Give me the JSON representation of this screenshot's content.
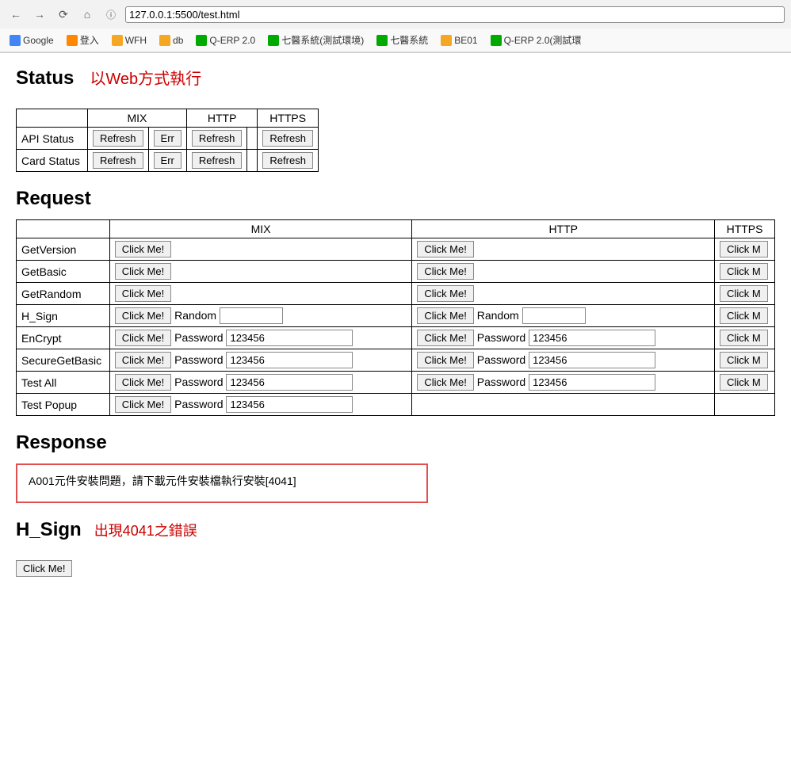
{
  "browser": {
    "url": "127.0.0.1:5500/test.html",
    "bookmarks": [
      {
        "label": "Google",
        "color": "#4285f4"
      },
      {
        "label": "登入",
        "color": "#ff8800"
      },
      {
        "label": "WFH",
        "color": "#f5a623"
      },
      {
        "label": "db",
        "color": "#f5a623"
      },
      {
        "label": "Q-ERP 2.0",
        "color": "#00aa00"
      },
      {
        "label": "七醫系統(測試環境)",
        "color": "#00aa00"
      },
      {
        "label": "七醫系統",
        "color": "#00aa00"
      },
      {
        "label": "BE01",
        "color": "#f5a623"
      },
      {
        "label": "Q-ERP 2.0(測試環",
        "color": "#00aa00"
      }
    ]
  },
  "status_section": {
    "title": "Status",
    "subtitle": "以Web方式執行",
    "table": {
      "headers": [
        "",
        "MIX",
        "",
        "HTTP",
        "",
        "HTTPS"
      ],
      "rows": [
        {
          "label": "API Status",
          "mix_btn": "Refresh",
          "mix_err": "Err",
          "http_btn": "Refresh",
          "http_sep": "",
          "https_btn": "Refresh"
        },
        {
          "label": "Card Status",
          "mix_btn": "Refresh",
          "mix_err": "Err",
          "http_btn": "Refresh",
          "http_sep": "",
          "https_btn": "Refresh"
        }
      ]
    }
  },
  "request_section": {
    "title": "Request",
    "col_headers": [
      "",
      "MIX",
      "HTTP",
      "HTTPS"
    ],
    "rows": [
      {
        "label": "GetVersion",
        "mix_btn": "Click Me!",
        "mix_extra": "",
        "http_btn": "Click Me!",
        "http_extra": "",
        "https_btn": "Click M"
      },
      {
        "label": "GetBasic",
        "mix_btn": "Click Me!",
        "mix_extra": "",
        "http_btn": "Click Me!",
        "http_extra": "",
        "https_btn": "Click M"
      },
      {
        "label": "GetRandom",
        "mix_btn": "Click Me!",
        "mix_extra": "",
        "http_btn": "Click Me!",
        "http_extra": "",
        "https_btn": "Click M"
      },
      {
        "label": "H_Sign",
        "mix_btn": "Click Me!",
        "mix_field_label": "Random",
        "mix_field_val": "",
        "http_btn": "Click Me!",
        "http_field_label": "Random",
        "http_field_val": "",
        "https_btn": "Click M"
      },
      {
        "label": "EnCrypt",
        "mix_btn": "Click Me!",
        "mix_field_label": "Password",
        "mix_field_val": "123456",
        "http_btn": "Click Me!",
        "http_field_label": "Password",
        "http_field_val": "123456",
        "https_btn": "Click M"
      },
      {
        "label": "SecureGetBasic",
        "mix_btn": "Click Me!",
        "mix_field_label": "Password",
        "mix_field_val": "123456",
        "http_btn": "Click Me!",
        "http_field_label": "Password",
        "http_field_val": "123456",
        "https_btn": "Click M"
      },
      {
        "label": "Test All",
        "mix_btn": "Click Me!",
        "mix_field_label": "Password",
        "mix_field_val": "123456",
        "http_btn": "Click Me!",
        "http_field_label": "Password",
        "http_field_val": "123456",
        "https_btn": "Click M"
      },
      {
        "label": "Test Popup",
        "mix_btn": "Click Me!",
        "mix_field_label": "Password",
        "mix_field_val": "123456",
        "http_btn": "",
        "http_field_label": "",
        "http_field_val": "",
        "https_btn": ""
      }
    ]
  },
  "response_section": {
    "title": "Response",
    "content": "A001元件安裝問題，請下載元件安裝檔執行安裝[4041]"
  },
  "hsign_section": {
    "title": "H_Sign",
    "subtitle": "出現4041之錯誤",
    "btn": "Click Me!"
  }
}
